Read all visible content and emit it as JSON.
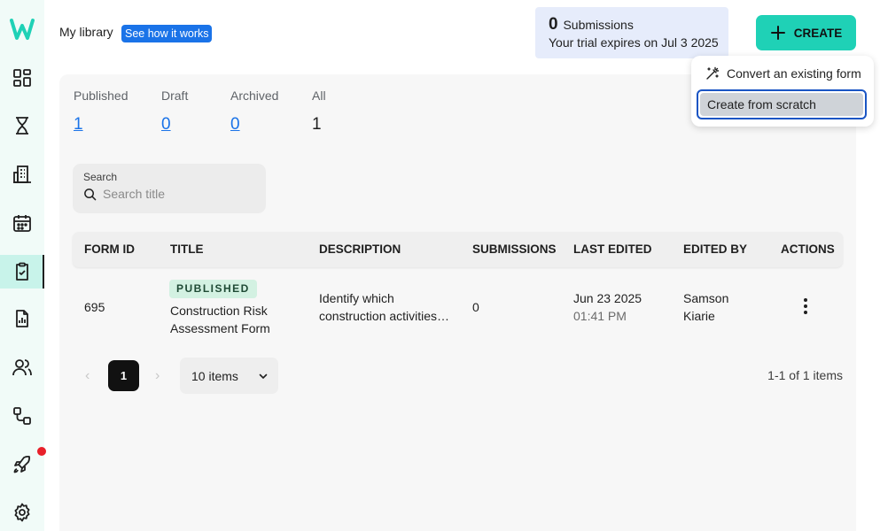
{
  "header": {
    "library_title": "My library",
    "how_it_works": "See how it works"
  },
  "trial": {
    "count": "0",
    "count_label": "Submissions",
    "expiry": "Your trial expires on Jul 3 2025"
  },
  "create": {
    "label": "CREATE",
    "menu": [
      {
        "label": "Convert an existing form"
      },
      {
        "label": "Create from scratch"
      }
    ]
  },
  "sidebar": {
    "items": [
      {
        "icon": "dashboard-icon"
      },
      {
        "icon": "hourglass-icon"
      },
      {
        "icon": "building-icon"
      },
      {
        "icon": "calendar-icon"
      },
      {
        "icon": "clipboard-check-icon",
        "active": true
      },
      {
        "icon": "report-icon"
      },
      {
        "icon": "users-icon"
      },
      {
        "icon": "workflow-icon"
      },
      {
        "icon": "rocket-icon",
        "notification": true
      },
      {
        "icon": "gear-icon"
      }
    ],
    "accent": "#1fd1b6",
    "notification_color": "#e8202a"
  },
  "stats": {
    "published": {
      "label": "Published",
      "value": "1"
    },
    "draft": {
      "label": "Draft",
      "value": "0"
    },
    "archived": {
      "label": "Archived",
      "value": "0"
    },
    "all": {
      "label": "All",
      "value": "1"
    }
  },
  "search": {
    "label": "Search",
    "placeholder": "Search title",
    "value": ""
  },
  "table": {
    "columns": {
      "form_id": "FORM ID",
      "title": "TITLE",
      "description": "DESCRIPTION",
      "submissions": "SUBMISSIONS",
      "last_edited": "LAST EDITED",
      "edited_by": "EDITED BY",
      "actions": "ACTIONS"
    },
    "rows": [
      {
        "form_id": "695",
        "status": "PUBLISHED",
        "title_line1": "Construction Risk",
        "title_line2": "Assessment Form",
        "description_line1": "Identify which",
        "description_line2": "construction activities…",
        "submissions": "0",
        "date": "Jun 23 2025",
        "time": "01:41 PM",
        "edited_by_line1": "Samson",
        "edited_by_line2": "Kiarie"
      }
    ]
  },
  "pagination": {
    "current_page": "1",
    "page_size": "10 items",
    "total": "1-1 of 1 items"
  },
  "colors": {
    "create_button": "#1fd1b6",
    "link_blue": "#1a73e8",
    "trial_bg": "#e6ecfb",
    "badge_bg": "#d3f1e2"
  }
}
